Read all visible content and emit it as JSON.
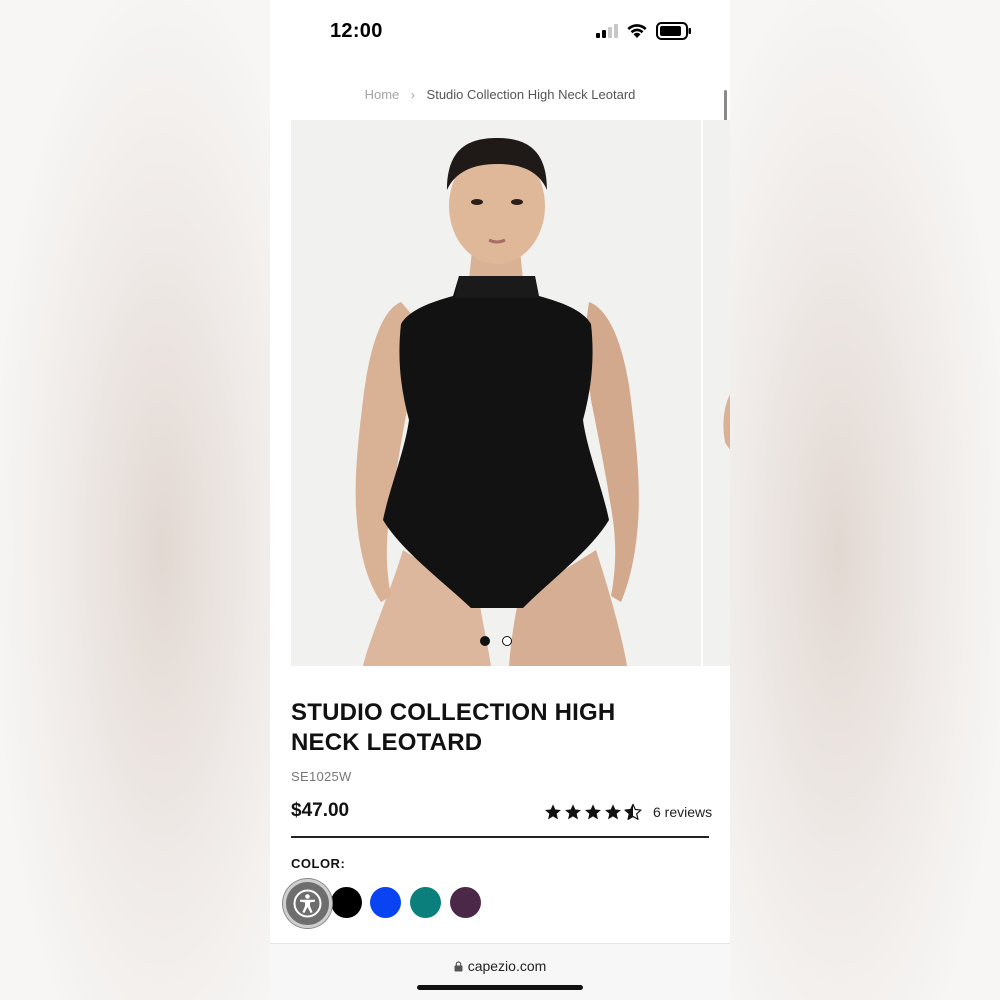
{
  "status_bar": {
    "time": "12:00"
  },
  "breadcrumb": {
    "home": "Home",
    "separator": "›",
    "current": "Studio Collection High Neck Leotard"
  },
  "gallery": {
    "image_count": 2,
    "active_index": 0
  },
  "product": {
    "title": "STUDIO COLLECTION HIGH NECK LEOTARD",
    "sku": "SE1025W",
    "price": "$47.00",
    "rating": 4.5,
    "rating_max": 5,
    "reviews_label": "6 reviews"
  },
  "color": {
    "label": "COLOR:",
    "swatches": [
      {
        "name": "black",
        "hex": "#000000"
      },
      {
        "name": "blue",
        "hex": "#0a44f2"
      },
      {
        "name": "teal",
        "hex": "#0b7f7c"
      },
      {
        "name": "plum",
        "hex": "#4b2848"
      }
    ]
  },
  "browser": {
    "url": "capezio.com"
  },
  "icons": {
    "signal": "cellular-signal-icon",
    "wifi": "wifi-icon",
    "battery": "battery-icon",
    "lock": "lock-icon",
    "accessibility": "accessibility-icon",
    "star": "star-icon"
  }
}
